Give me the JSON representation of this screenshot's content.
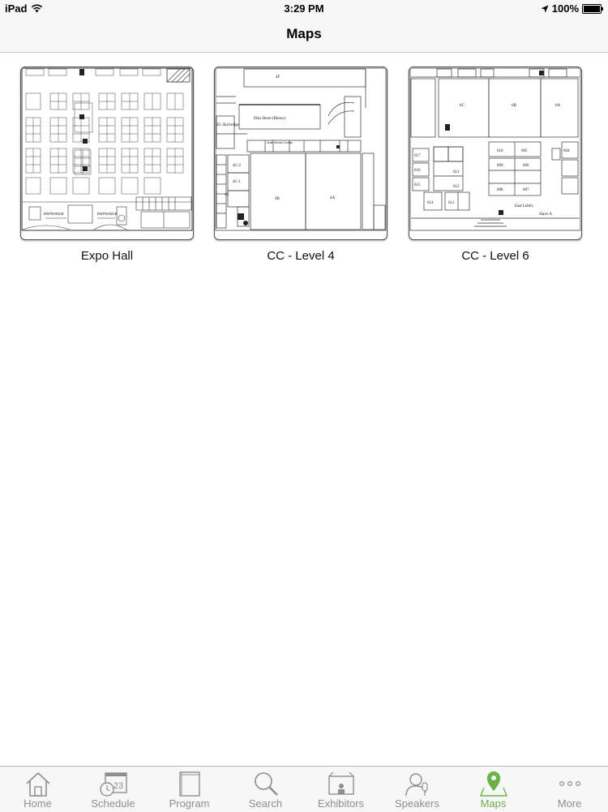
{
  "status_bar": {
    "device": "iPad",
    "time": "3:29 PM",
    "battery": "100%"
  },
  "nav": {
    "title": "Maps"
  },
  "maps": [
    {
      "label": "Expo Hall"
    },
    {
      "label": "CC - Level 4"
    },
    {
      "label": "CC - Level 6"
    }
  ],
  "map_text": {
    "level4": {
      "r4f": "4F",
      "elks": "Elks Street (Below)",
      "skybridge": "4G Skybridge",
      "r4c2": "4C-2",
      "r4c1": "4C-1",
      "r4c": "4C",
      "r4b": "4B",
      "r4a": "4A",
      "corridor": "South Service Corridor"
    },
    "level6": {
      "r6c": "6C",
      "r6b": "6B",
      "r6a": "6A",
      "r610": "610",
      "r605": "605",
      "r611": "611",
      "r609": "609",
      "r606": "606",
      "r612": "612",
      "r608": "608",
      "r607": "607",
      "r617": "617",
      "r616": "616",
      "r615": "615",
      "r614": "614",
      "r613": "613",
      "r604": "604",
      "lobby": "East Lobby",
      "stairs_a": "Stairs A"
    },
    "expo": {
      "entrance1": "ENTRANCE",
      "entrance2": "ENTRANCE"
    }
  },
  "tabs": [
    {
      "label": "Home",
      "icon": "house-icon"
    },
    {
      "label": "Schedule",
      "icon": "calendar-clock-icon",
      "badge": "23"
    },
    {
      "label": "Program",
      "icon": "book-icon"
    },
    {
      "label": "Search",
      "icon": "magnifier-icon"
    },
    {
      "label": "Exhibitors",
      "icon": "exhibitor-icon"
    },
    {
      "label": "Speakers",
      "icon": "speaker-icon"
    },
    {
      "label": "Maps",
      "icon": "map-pin-icon",
      "active": true
    },
    {
      "label": "More",
      "icon": "more-dots-icon"
    }
  ],
  "colors": {
    "active_tab": "#6cb04a",
    "inactive_tab": "#8e8e8e",
    "bar_background": "#f7f7f7"
  }
}
